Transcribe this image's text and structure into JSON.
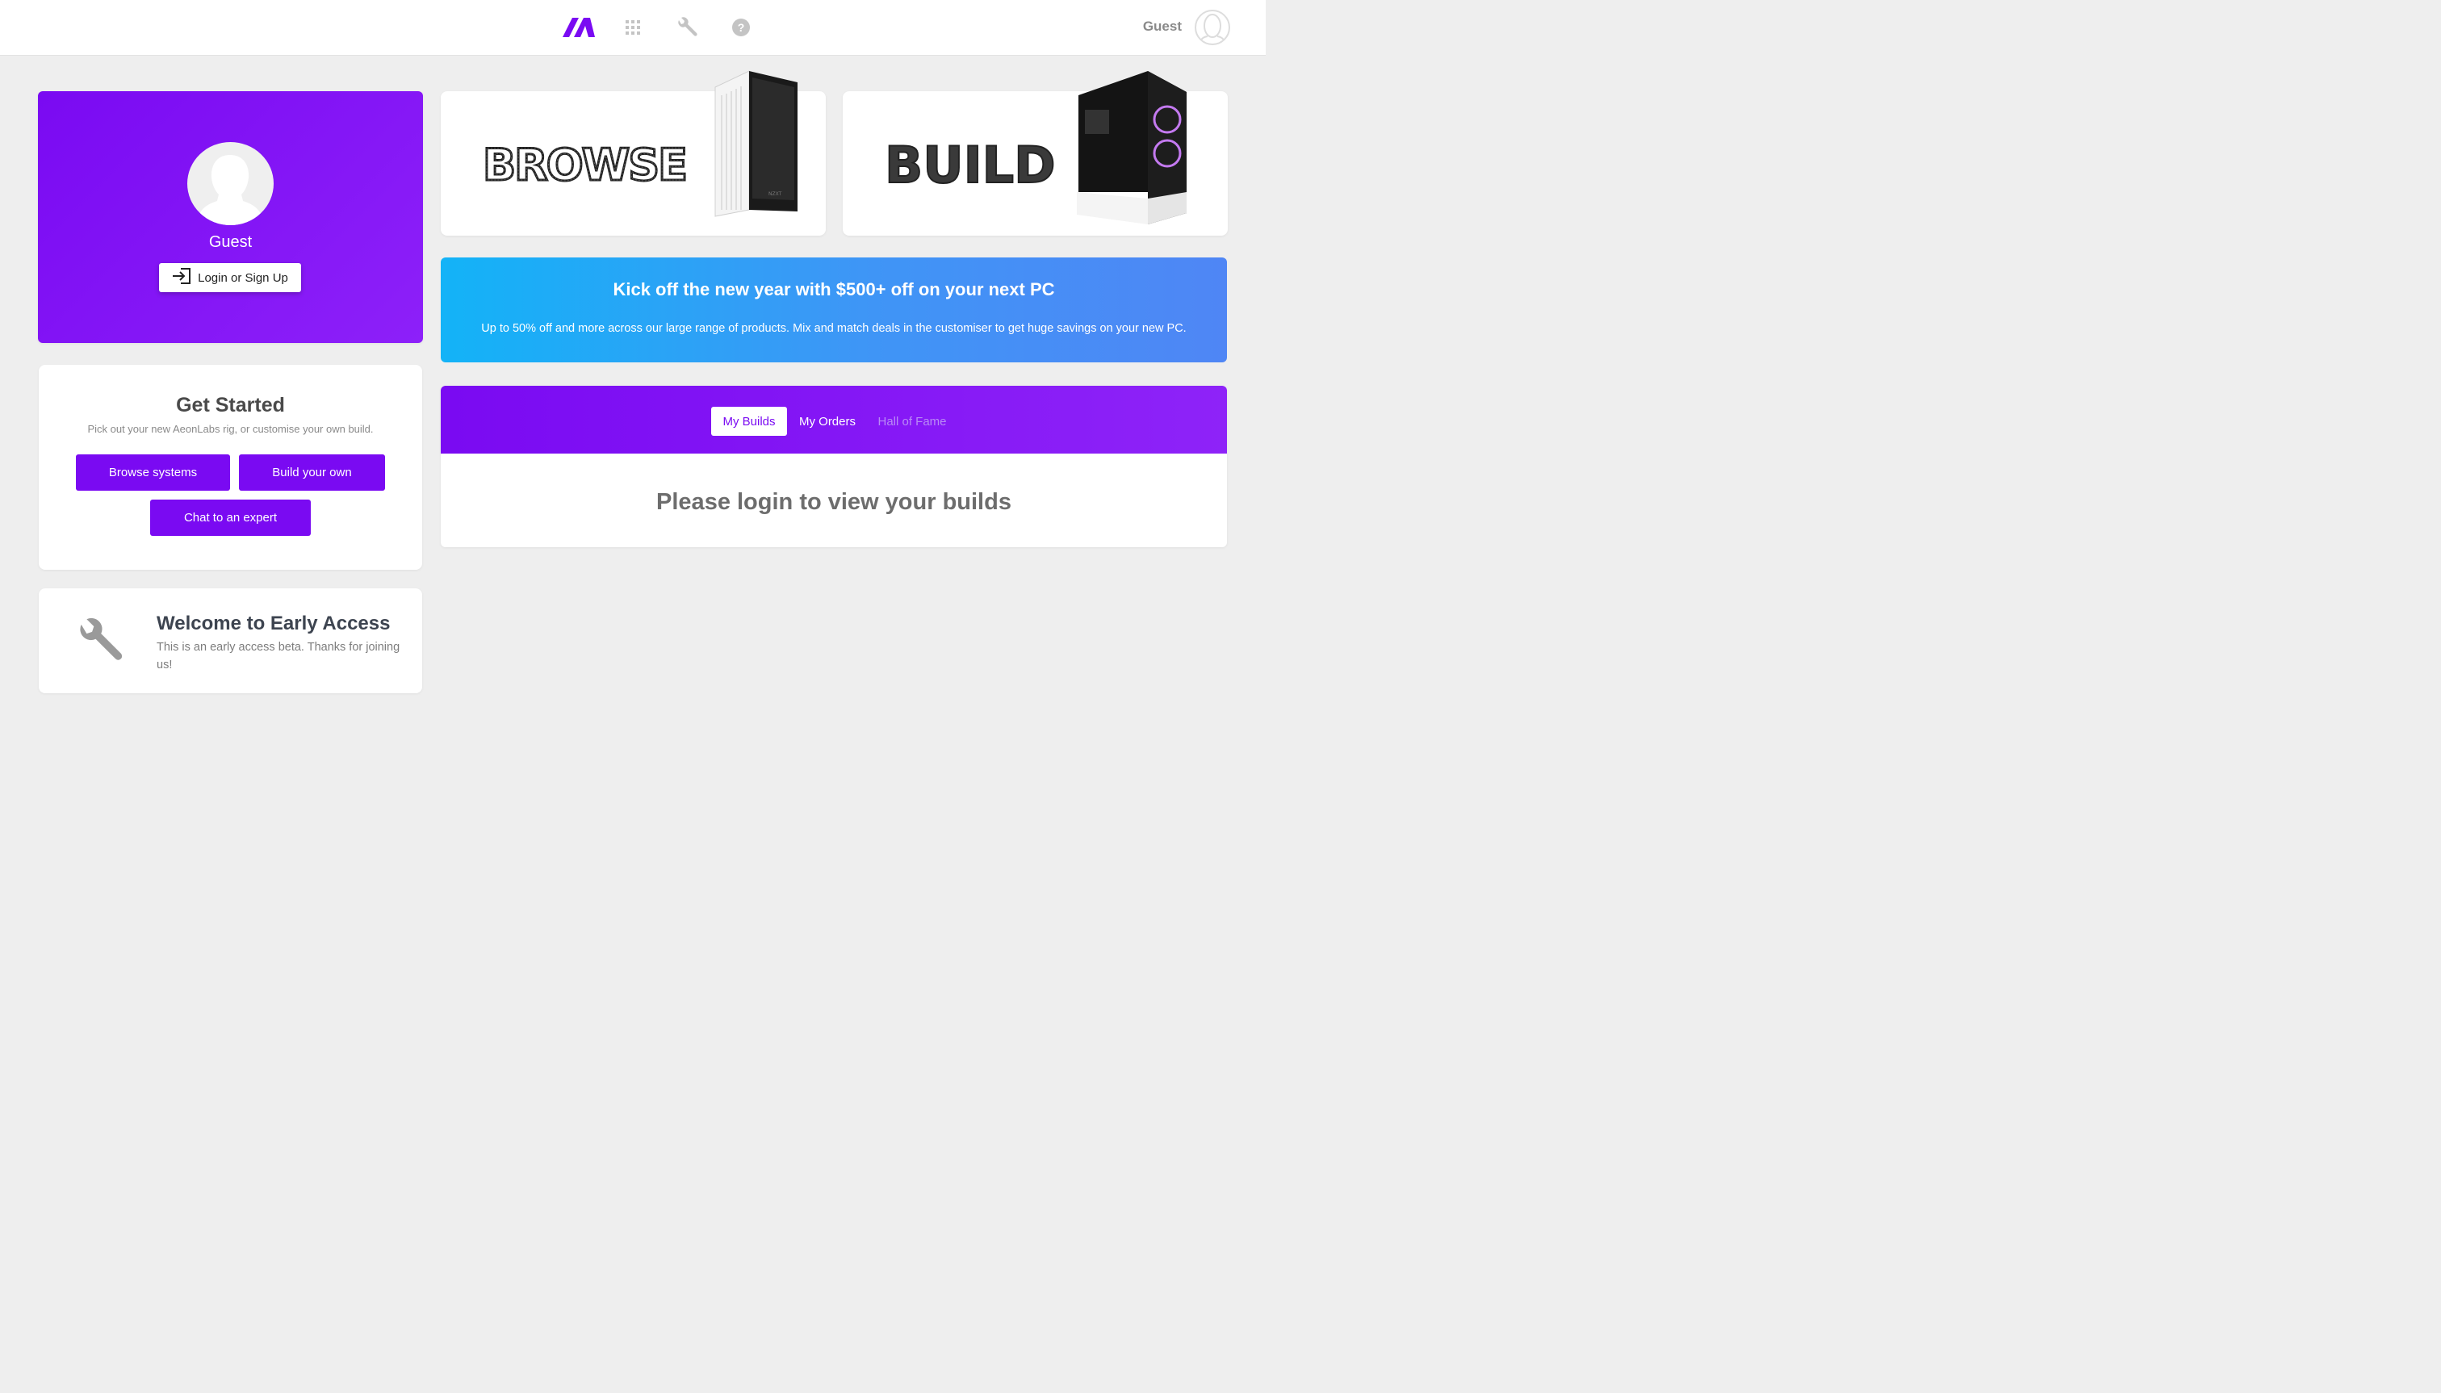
{
  "header": {
    "logo_icon": "aeon-logo-icon",
    "nav_icons": [
      "apps-grid-icon",
      "wrench-icon",
      "help-icon"
    ],
    "user_name": "Guest",
    "accent_color": "#7a0af2"
  },
  "profile": {
    "name": "Guest",
    "login_label": "Login or Sign Up"
  },
  "get_started": {
    "title": "Get Started",
    "subtitle": "Pick out your new AeonLabs rig, or customise your own build.",
    "browse_label": "Browse systems",
    "build_label": "Build your own",
    "chat_label": "Chat to an expert"
  },
  "early_access": {
    "title": "Welcome to Early Access",
    "text": "This is an early access beta. Thanks for joining us!"
  },
  "tiles": {
    "browse_label": "BROWSE",
    "build_label": "BUILD",
    "case_text": "NZXT"
  },
  "promo": {
    "title": "Kick off the new year with $500+ off on your next PC",
    "subtitle": "Up to 50% off and more across our large range of products. Mix and match deals in the customiser to get huge savings on your new PC."
  },
  "builds": {
    "tabs": [
      "My Builds",
      "My Orders",
      "Hall of Fame"
    ],
    "message": "Please login to view your builds"
  }
}
